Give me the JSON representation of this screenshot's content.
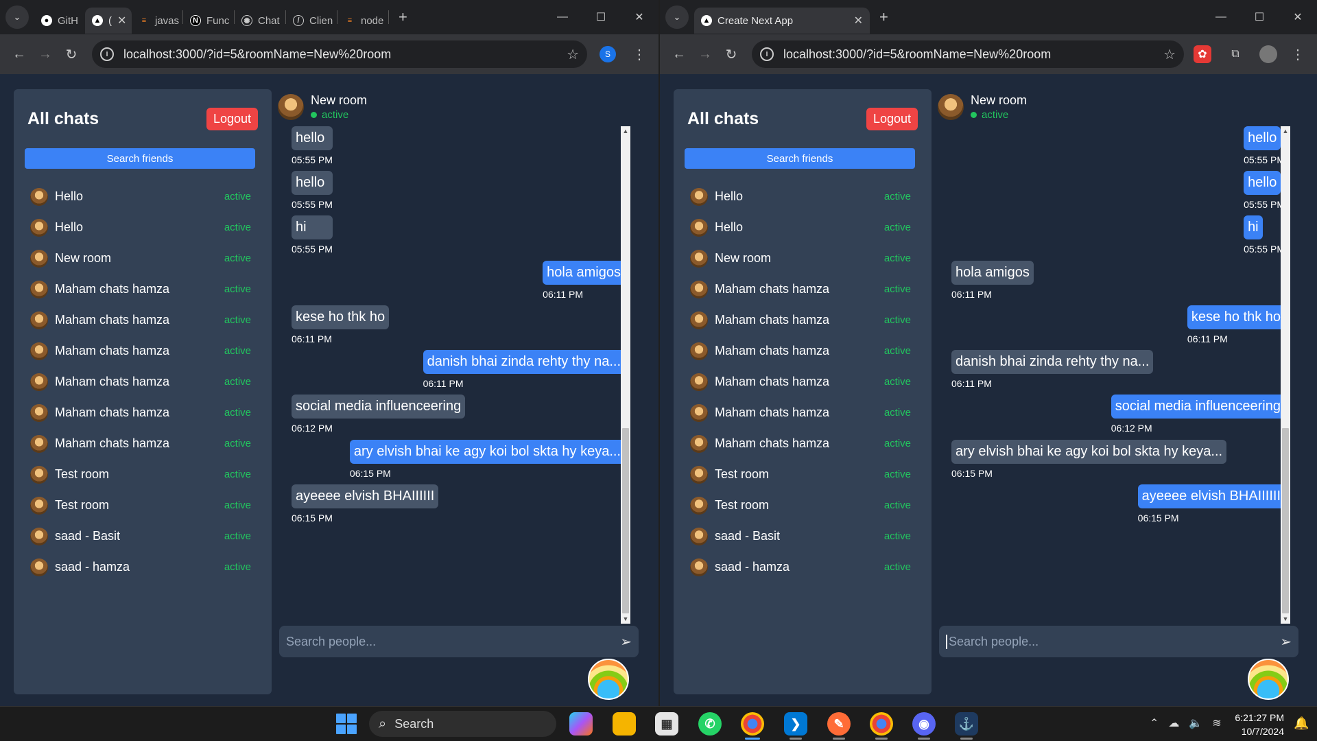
{
  "left_window": {
    "tabs": [
      {
        "label": "GitH",
        "icon": "github-icon",
        "active": false
      },
      {
        "label": "(",
        "icon": "nextjs-icon",
        "active": true
      },
      {
        "label": "javas",
        "icon": "stackoverflow-icon",
        "active": false
      },
      {
        "label": "Func",
        "icon": "nextjs-icon",
        "active": false
      },
      {
        "label": "Chat",
        "icon": "chatgpt-icon",
        "active": false
      },
      {
        "label": "Clien",
        "icon": "nextjs-icon",
        "active": false
      },
      {
        "label": "node",
        "icon": "stackoverflow-icon",
        "active": false
      }
    ],
    "url": "localhost:3000/?id=5&roomName=New%20room",
    "profile_initial": "S"
  },
  "right_window": {
    "tabs": [
      {
        "label": "Create Next App",
        "icon": "nextjs-icon",
        "active": true
      }
    ],
    "url": "localhost:3000/?id=5&roomName=New%20room"
  },
  "sidebar": {
    "title": "All chats",
    "logout_label": "Logout",
    "search_label": "Search friends",
    "rooms": [
      {
        "name": "Hello",
        "status": "active"
      },
      {
        "name": "Hello",
        "status": "active"
      },
      {
        "name": "New room",
        "status": "active"
      },
      {
        "name": "Maham chats hamza",
        "status": "active"
      },
      {
        "name": "Maham chats hamza",
        "status": "active"
      },
      {
        "name": "Maham chats hamza",
        "status": "active"
      },
      {
        "name": "Maham chats hamza",
        "status": "active"
      },
      {
        "name": "Maham chats hamza",
        "status": "active"
      },
      {
        "name": "Maham chats hamza",
        "status": "active"
      },
      {
        "name": "Test room",
        "status": "active"
      },
      {
        "name": "Test room",
        "status": "active"
      },
      {
        "name": "saad - Basit",
        "status": "active"
      },
      {
        "name": "saad - hamza",
        "status": "active"
      }
    ]
  },
  "chat": {
    "room_name": "New room",
    "room_status": "active",
    "input_placeholder": "Search people...",
    "messages": [
      {
        "text": "hello",
        "time": "05:55 PM",
        "left_sender": "other"
      },
      {
        "text": "hello",
        "time": "05:55 PM",
        "left_sender": "other"
      },
      {
        "text": "hi",
        "time": "05:55 PM",
        "left_sender": "other"
      },
      {
        "text": "hola amigos",
        "time": "06:11 PM",
        "left_sender": "me"
      },
      {
        "text": "kese ho thk ho",
        "time": "06:11 PM",
        "left_sender": "other"
      },
      {
        "text": "danish bhai zinda rehty thy na...",
        "time": "06:11 PM",
        "left_sender": "me"
      },
      {
        "text": "social media influenceering",
        "time": "06:12 PM",
        "left_sender": "other"
      },
      {
        "text": "ary elvish bhai ke agy koi bol skta hy keya...",
        "time": "06:15 PM",
        "left_sender": "me"
      },
      {
        "text": "ayeeee elvish BHAIIIIII",
        "time": "06:15 PM",
        "left_sender": "other"
      }
    ]
  },
  "taskbar": {
    "search_label": "Search",
    "time": "6:21:27 PM",
    "date": "10/7/2024"
  },
  "colors": {
    "page_bg": "#1e293b",
    "panel_bg": "#334155",
    "outgoing_bubble": "#3b82f6",
    "incoming_bubble": "#475569",
    "logout": "#ef4444",
    "status_active": "#22c55e"
  }
}
